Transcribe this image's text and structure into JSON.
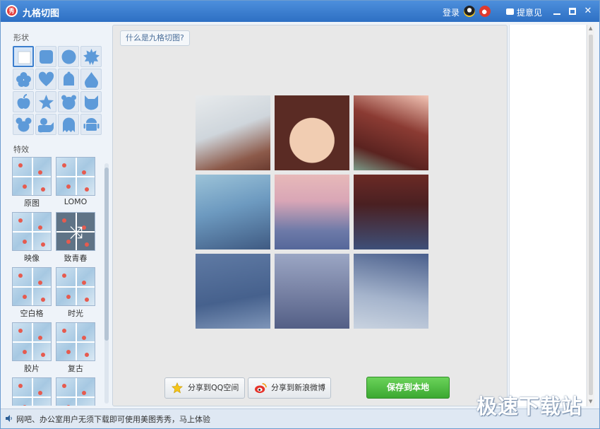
{
  "window": {
    "logo_glyph": "秀",
    "title": "九格切图",
    "login": "登录",
    "feedback": "提意见",
    "minimize_icon": "minimize-icon",
    "maximize_icon": "maximize-icon",
    "close_glyph": "✕"
  },
  "sidebar": {
    "shapes_label": "形状",
    "shapes": [
      "square",
      "rounded-square",
      "circle",
      "starburst",
      "flower",
      "heart",
      "bell",
      "drop",
      "apple",
      "star",
      "bear",
      "cat",
      "mouse",
      "duck",
      "ghost",
      "android"
    ],
    "selected_shape": "square",
    "effects_label": "特效",
    "effects": [
      {
        "name": "原图"
      },
      {
        "name": "LOMO"
      },
      {
        "name": "映像"
      },
      {
        "name": "致青春"
      },
      {
        "name": "空白格"
      },
      {
        "name": "时光"
      },
      {
        "name": "胶片"
      },
      {
        "name": "复古"
      },
      {
        "name": ""
      },
      {
        "name": ""
      }
    ],
    "selected_effect": "致青春"
  },
  "canvas": {
    "help_button": "什么是九格切图?",
    "grid_size": "3x3",
    "share_qzone": "分享到QQ空间",
    "share_weibo": "分享到新浪微博",
    "save": "保存到本地"
  },
  "statusbar": {
    "text": "网吧、办公室用户无须下载即可使用美图秀秀，马上体验"
  },
  "watermark": "极速下载站",
  "colors": {
    "titlebar": "#3a7ccf",
    "accent": "#3c7fce",
    "save_button": "#4cb83f",
    "shape_fill": "#5d9ad9"
  }
}
